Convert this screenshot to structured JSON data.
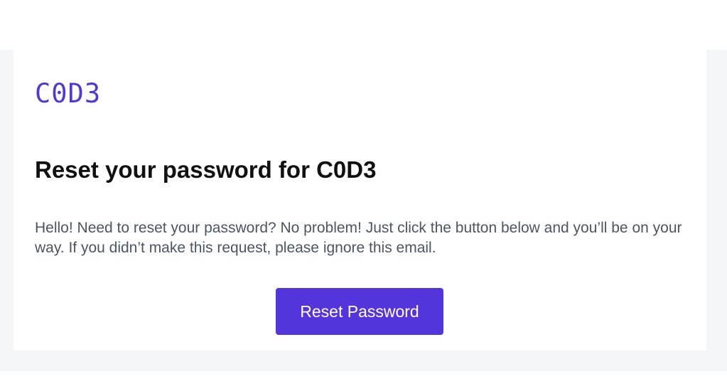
{
  "email": {
    "logo_text": "C0D3",
    "title": "Reset your password for C0D3",
    "message": "Hello! Need to reset your password? No problem! Just click the button below and you’ll be on your way. If you didn’t make this request, please ignore this email.",
    "button_label": "Reset Password"
  },
  "colors": {
    "brand": "#5435dc",
    "background": "#f4f5f7",
    "card": "#ffffff",
    "heading": "#111111",
    "body_text": "#4b5563"
  }
}
